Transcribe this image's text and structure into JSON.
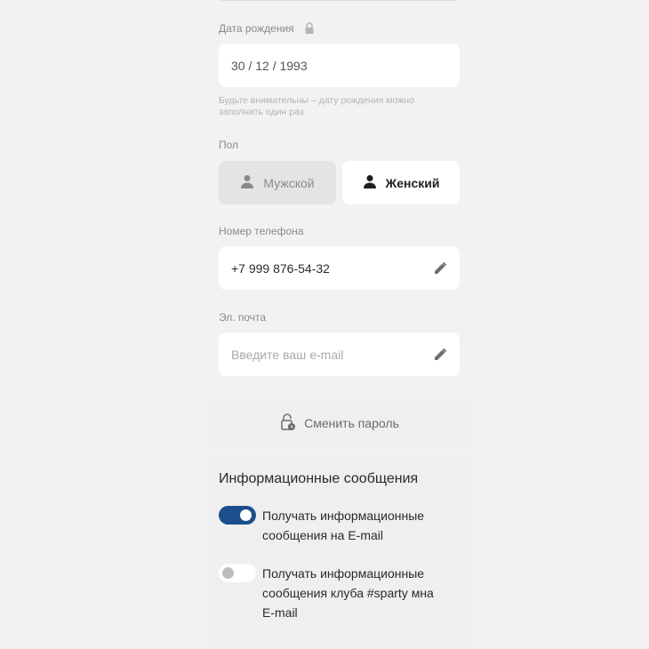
{
  "birthdate": {
    "label": "Дата рождения",
    "value": "30 / 12 / 1993",
    "hint": "Будьте внимательны – дату рождения можно заполнить один раз"
  },
  "gender": {
    "label": "Пол",
    "male": "Мужской",
    "female": "Женский",
    "selected": "female"
  },
  "phone": {
    "label": "Номер телефона",
    "value": "+7 999 876-54-32"
  },
  "email": {
    "label": "Эл. почта",
    "placeholder": "Введите ваш e-mail"
  },
  "change_password": {
    "label": "Сменить пароль"
  },
  "notifications": {
    "title": "Информационные сообщения",
    "items": [
      {
        "text": "Получать информационные сообщения на E-mail",
        "enabled": true
      },
      {
        "text": "Получать информационные сообщения клуба #sparty мна E-mail",
        "enabled": false
      }
    ]
  },
  "colors": {
    "accent": "#1b4f8c",
    "background": "#f3f2f1",
    "field": "#ffffff"
  },
  "icons": [
    "lock-icon",
    "user-icon",
    "pencil-icon",
    "lock-clock-icon"
  ]
}
